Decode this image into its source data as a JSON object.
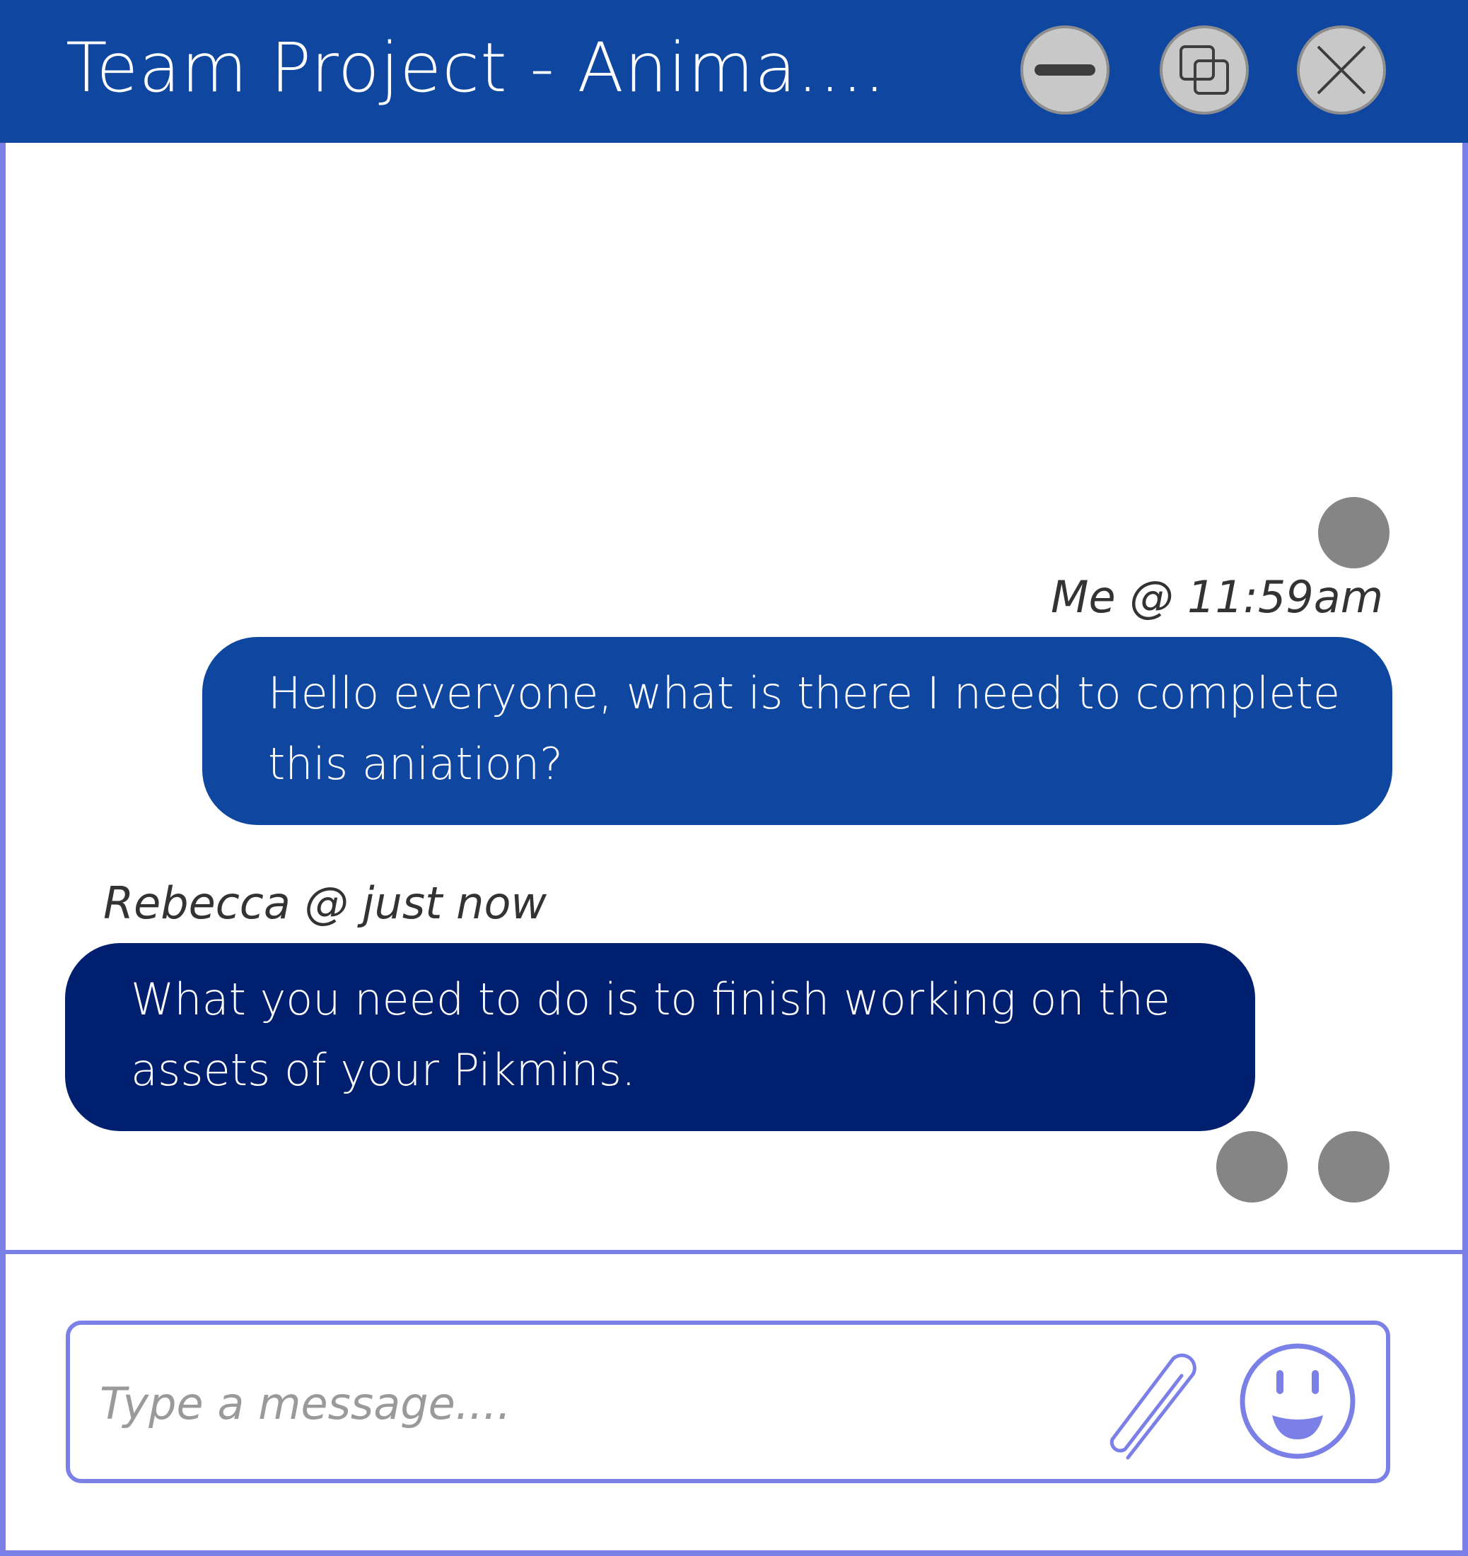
{
  "window": {
    "title": "Team Project - Anima....",
    "controls": {
      "minimize_icon": "minimize-icon",
      "restore_icon": "restore-icon",
      "close_icon": "close-icon"
    }
  },
  "messages": [
    {
      "sender": "Me",
      "meta": "Me @ 11:59am",
      "lines": [
        "Hello everyone, what is there I need to complete",
        "this aniation?"
      ]
    },
    {
      "sender": "Rebecca",
      "meta": "Rebecca @ just now",
      "lines": [
        "What you need to do is to finish working on the",
        "assets of your Pikmins."
      ]
    }
  ],
  "composer": {
    "value": "",
    "placeholder": "Type a message....",
    "attach_icon": "paperclip-icon",
    "emoji_icon": "smiley-icon"
  },
  "colors": {
    "titlebar": "#0e46a0",
    "border": "#7b80e6",
    "bubble_mine": "#0e46a0",
    "bubble_theirs": "#001f6e",
    "avatar": "#858585"
  }
}
